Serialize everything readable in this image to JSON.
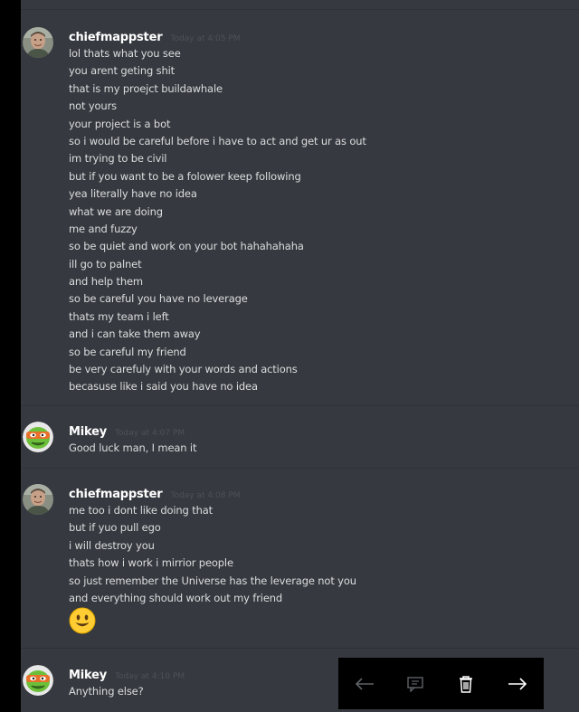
{
  "messages": [
    {
      "username": "chiefmappster",
      "timestamp": "Today at 4:05 PM",
      "avatar": "person-photo-avatar",
      "lines": [
        "lol thats what you see",
        "you arent geting shit",
        "that is my proejct buildawhale",
        "not yours",
        "your project is a bot",
        "so i would be careful before i have to act and get ur as out",
        "im trying to be civil",
        "but if you want to be a folower keep following",
        "yea literally have no idea",
        "what we are doing",
        "me and fuzzy",
        "so be quiet and work on your bot hahahahaha",
        "ill go to palnet",
        "and help them",
        "so be careful you have no leverage",
        "thats my team i left",
        "and i can take them away",
        "so be careful my friend",
        "be very carefuly with your words and actions",
        "becasuse like i said you have no idea"
      ]
    },
    {
      "username": "Mikey",
      "timestamp": "Today at 4:07 PM",
      "avatar": "ninja-turtle-avatar",
      "lines": [
        "Good luck man, I mean it"
      ]
    },
    {
      "username": "chiefmappster",
      "timestamp": "Today at 4:08 PM",
      "avatar": "person-photo-avatar",
      "lines": [
        "me too i dont like doing that",
        "but if yuo pull ego",
        "i will destroy you",
        "thats how i work i mirrior people",
        "so just remember the Universe has the leverage not you",
        "and everything should work out my friend"
      ],
      "emoji": "smiley-emoji"
    },
    {
      "username": "Mikey",
      "timestamp": "Today at 4:10 PM",
      "avatar": "ninja-turtle-avatar",
      "lines": [
        "Anything else?"
      ]
    }
  ],
  "toolbar": {
    "icons": [
      "back-arrow-icon",
      "comment-icon",
      "trash-icon",
      "forward-arrow-icon"
    ]
  },
  "colors": {
    "background": "#36393f",
    "username": "#ffffff",
    "message_text": "#dcddde",
    "timestamp": "#4e5157",
    "toolbar": "#000000"
  }
}
